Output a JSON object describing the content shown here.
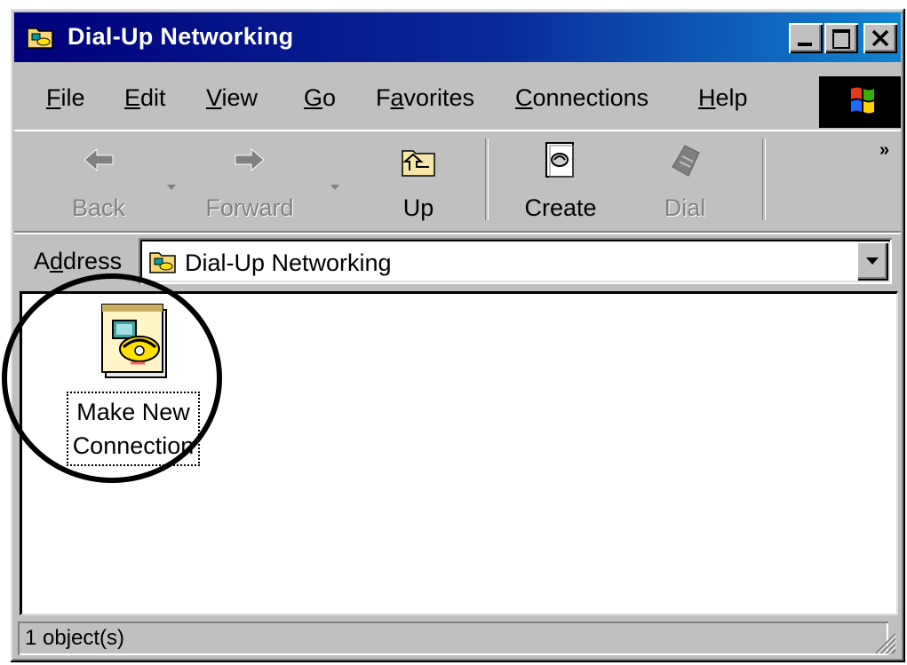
{
  "window": {
    "title": "Dial-Up Networking",
    "title_icon": "dialup-folder-icon"
  },
  "menu": {
    "items": [
      {
        "label": "File",
        "access": "F",
        "rest": "ile"
      },
      {
        "label": "Edit",
        "access": "E",
        "rest": "dit"
      },
      {
        "label": "View",
        "access": "V",
        "rest": "iew"
      },
      {
        "label": "Go",
        "access": "G",
        "rest": "o"
      },
      {
        "label": "Favorites",
        "pre": "F",
        "access": "a",
        "rest": "vorites"
      },
      {
        "label": "Connections",
        "access": "C",
        "rest": "onnections"
      },
      {
        "label": "Help",
        "access": "H",
        "rest": "elp"
      }
    ]
  },
  "toolbar": {
    "back_label": "Back",
    "forward_label": "Forward",
    "up_label": "Up",
    "create_label": "Create",
    "dial_label": "Dial",
    "more_label": "»"
  },
  "address": {
    "pre": "A",
    "access": "d",
    "rest": "dress",
    "value": "Dial-Up Networking"
  },
  "items": [
    {
      "line1": "Make New",
      "line2": "Connection",
      "icon": "make-new-connection-icon"
    }
  ],
  "status": {
    "text": "1 object(s)"
  },
  "colors": {
    "titlebar_start": "#00007b",
    "titlebar_end": "#1084d0",
    "face": "#c0c0c0"
  }
}
